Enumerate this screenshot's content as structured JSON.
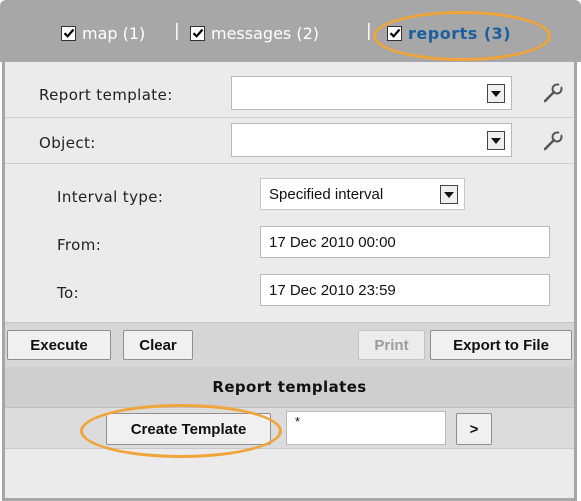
{
  "tabs": [
    {
      "label": "map (1)",
      "checked": true
    },
    {
      "label": "messages (2)",
      "checked": true
    },
    {
      "label": "reports (3)",
      "checked": true,
      "active": true
    }
  ],
  "tab_separator": "|",
  "form": {
    "report_template_label": "Report template:",
    "report_template_value": "",
    "object_label": "Object:",
    "object_value": "",
    "interval_type_label": "Interval type:",
    "interval_type_value": "Specified interval",
    "from_label": "From:",
    "from_value": "17 Dec 2010 00:00",
    "to_label": "To:",
    "to_value": "17 Dec 2010 23:59"
  },
  "buttons": {
    "execute": "Execute",
    "clear": "Clear",
    "print": "Print",
    "export": "Export to File"
  },
  "report_templates": {
    "header": "Report templates",
    "create_button": "Create Template",
    "filter_value": "*",
    "next_button": ">"
  },
  "colors": {
    "highlight": "#f0a43a",
    "active_tab_text": "#1b5fa0",
    "tab_bar": "#a7a7a7"
  }
}
